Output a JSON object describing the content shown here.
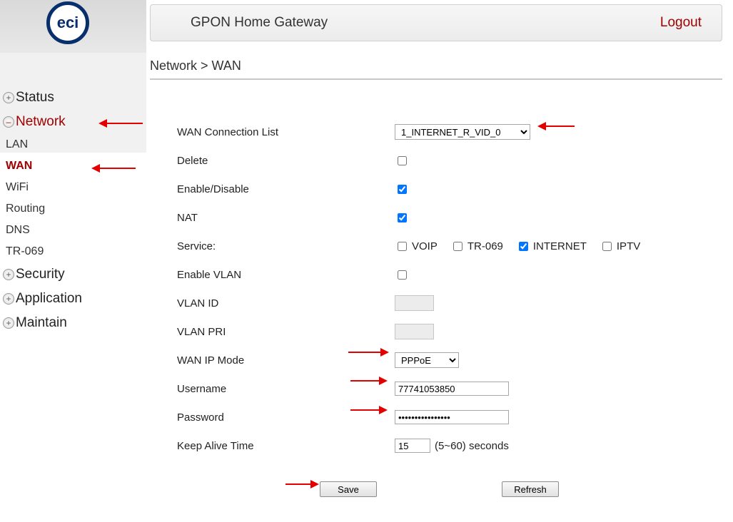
{
  "header": {
    "title": "GPON Home Gateway",
    "logout": "Logout",
    "logo": "eci"
  },
  "breadcrumb": "Network > WAN",
  "sidebar": {
    "sections": [
      {
        "label": "Status",
        "expanded": false
      },
      {
        "label": "Network",
        "expanded": true,
        "subs": [
          {
            "label": "LAN",
            "active": false
          },
          {
            "label": "WAN",
            "active": true
          },
          {
            "label": "WiFi",
            "active": false
          },
          {
            "label": "Routing",
            "active": false
          },
          {
            "label": "DNS",
            "active": false
          },
          {
            "label": "TR-069",
            "active": false
          }
        ]
      },
      {
        "label": "Security",
        "expanded": false
      },
      {
        "label": "Application",
        "expanded": false
      },
      {
        "label": "Maintain",
        "expanded": false
      }
    ]
  },
  "form": {
    "wan_list_label": "WAN Connection List",
    "wan_list_value": "1_INTERNET_R_VID_0",
    "delete_label": "Delete",
    "delete_checked": false,
    "enable_label": "Enable/Disable",
    "enable_checked": true,
    "nat_label": "NAT",
    "nat_checked": true,
    "service_label": "Service:",
    "services": [
      {
        "label": "VOIP",
        "checked": false
      },
      {
        "label": "TR-069",
        "checked": false
      },
      {
        "label": "INTERNET",
        "checked": true
      },
      {
        "label": "IPTV",
        "checked": false
      }
    ],
    "enable_vlan_label": "Enable VLAN",
    "enable_vlan_checked": false,
    "vlan_id_label": "VLAN ID",
    "vlan_id_value": "",
    "vlan_pri_label": "VLAN PRI",
    "vlan_pri_value": "",
    "wan_ip_mode_label": "WAN IP Mode",
    "wan_ip_mode_value": "PPPoE",
    "username_label": "Username",
    "username_value": "77741053850",
    "password_label": "Password",
    "password_value": "••••••••••••••••",
    "keepalive_label": "Keep Alive Time",
    "keepalive_value": "15",
    "keepalive_suffix": "(5~60) seconds",
    "save_label": "Save",
    "refresh_label": "Refresh"
  }
}
